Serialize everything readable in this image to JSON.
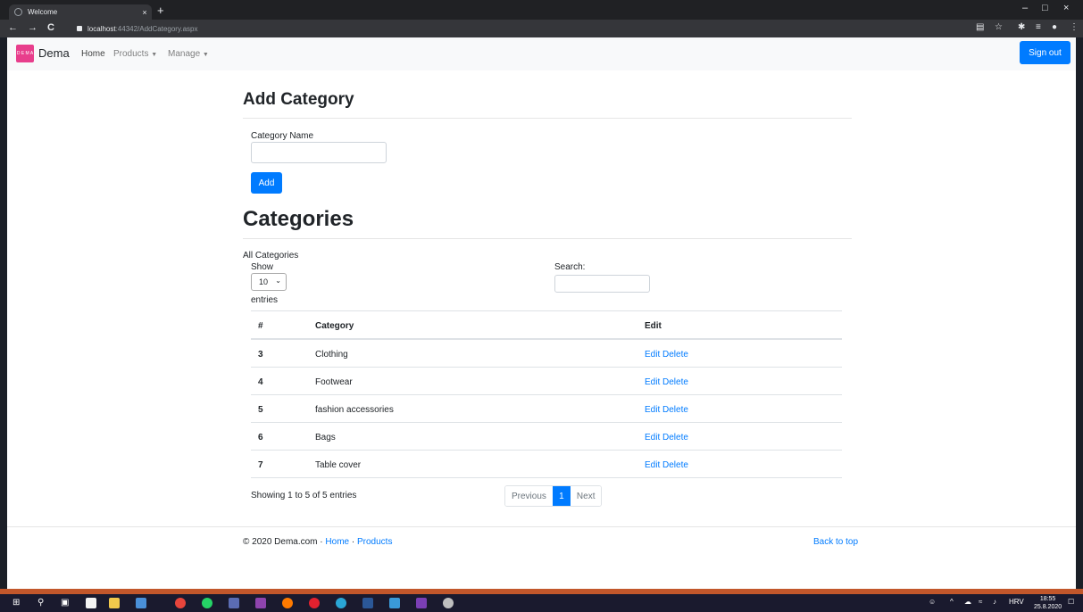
{
  "browser": {
    "tab_title": "Welcome",
    "tab_close": "×",
    "new_tab": "+",
    "url_host": "localhost",
    "url_path": ":44342/AddCategory.aspx",
    "back": "←",
    "forward": "→",
    "reload": "C"
  },
  "window": {
    "minimize": "–",
    "maximize": "□",
    "close": "×"
  },
  "navbar": {
    "logo": "D E M A",
    "brand": "Dema",
    "home": "Home",
    "products": "Products",
    "manage": "Manage",
    "signout": "Sign out"
  },
  "add_form": {
    "heading": "Add Category",
    "label": "Category Name",
    "value": "",
    "button": "Add"
  },
  "categories": {
    "heading": "Categories",
    "caption": "All Categories",
    "show": "Show",
    "page_length": "10",
    "entries": "entries",
    "search_label": "Search:",
    "columns": [
      "#",
      "Category",
      "Edit"
    ],
    "rows": [
      {
        "id": "3",
        "name": "Clothing",
        "edit": "Edit",
        "delete": "Delete"
      },
      {
        "id": "4",
        "name": "Footwear",
        "edit": "Edit",
        "delete": "Delete"
      },
      {
        "id": "5",
        "name": "fashion accessories",
        "edit": "Edit",
        "delete": "Delete"
      },
      {
        "id": "6",
        "name": "Bags",
        "edit": "Edit",
        "delete": "Delete"
      },
      {
        "id": "7",
        "name": "Table cover",
        "edit": "Edit",
        "delete": "Delete"
      }
    ],
    "info": "Showing 1 to 5 of 5 entries",
    "prev": "Previous",
    "page": "1",
    "next": "Next"
  },
  "footer": {
    "copyright": "© 2020 Dema.com · ",
    "home": "Home",
    "sep": " · ",
    "products": "Products",
    "back_to_top": "Back to top"
  },
  "taskbar": {
    "lang": "HRV",
    "time": "18:55",
    "date": "25.8.2020"
  }
}
